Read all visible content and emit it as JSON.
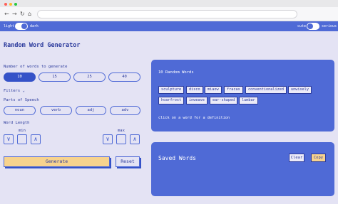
{
  "browser": {
    "dots": [
      "#ff5f57",
      "#febc2e",
      "#28c840"
    ],
    "nav": {
      "back": "←",
      "forward": "→",
      "reload": "↻",
      "home": "⌂"
    }
  },
  "topbar": {
    "theme_left": "light",
    "theme_right": "dark",
    "tone_left": "cute",
    "tone_right": "serious"
  },
  "title": "Random Word Generator",
  "count": {
    "label": "Number of words to generate",
    "options": [
      "10",
      "15",
      "25",
      "40"
    ],
    "selected": "10"
  },
  "filters_label": "Filters",
  "filters_chevron": "chevron-down-icon",
  "parts_of_speech": {
    "label": "Parts of Speech",
    "options": [
      "noun",
      "verb",
      "adj",
      "adv"
    ]
  },
  "word_length": {
    "label": "Word Length",
    "min_label": "min",
    "max_label": "max",
    "down_glyph": "∨",
    "up_glyph": "∧"
  },
  "buttons": {
    "generate": "Generate",
    "reset": "Reset"
  },
  "random_panel": {
    "title": "10 Random Words",
    "words": [
      "sculpture",
      "disco",
      "miaow",
      "fracas",
      "conventionalized",
      "unwisely",
      "hoarfrost",
      "inweave",
      "ear-shaped",
      "lumbar"
    ],
    "hint": "click on a word for a definition"
  },
  "saved_panel": {
    "title": "Saved Words",
    "clear": "Clear",
    "copy": "Copy"
  },
  "colors": {
    "accent": "#4f6ad6",
    "accent_dark": "#3552c8",
    "background": "#e4e3f4",
    "highlight": "#f7d38e",
    "text": "#2b3a9c"
  }
}
